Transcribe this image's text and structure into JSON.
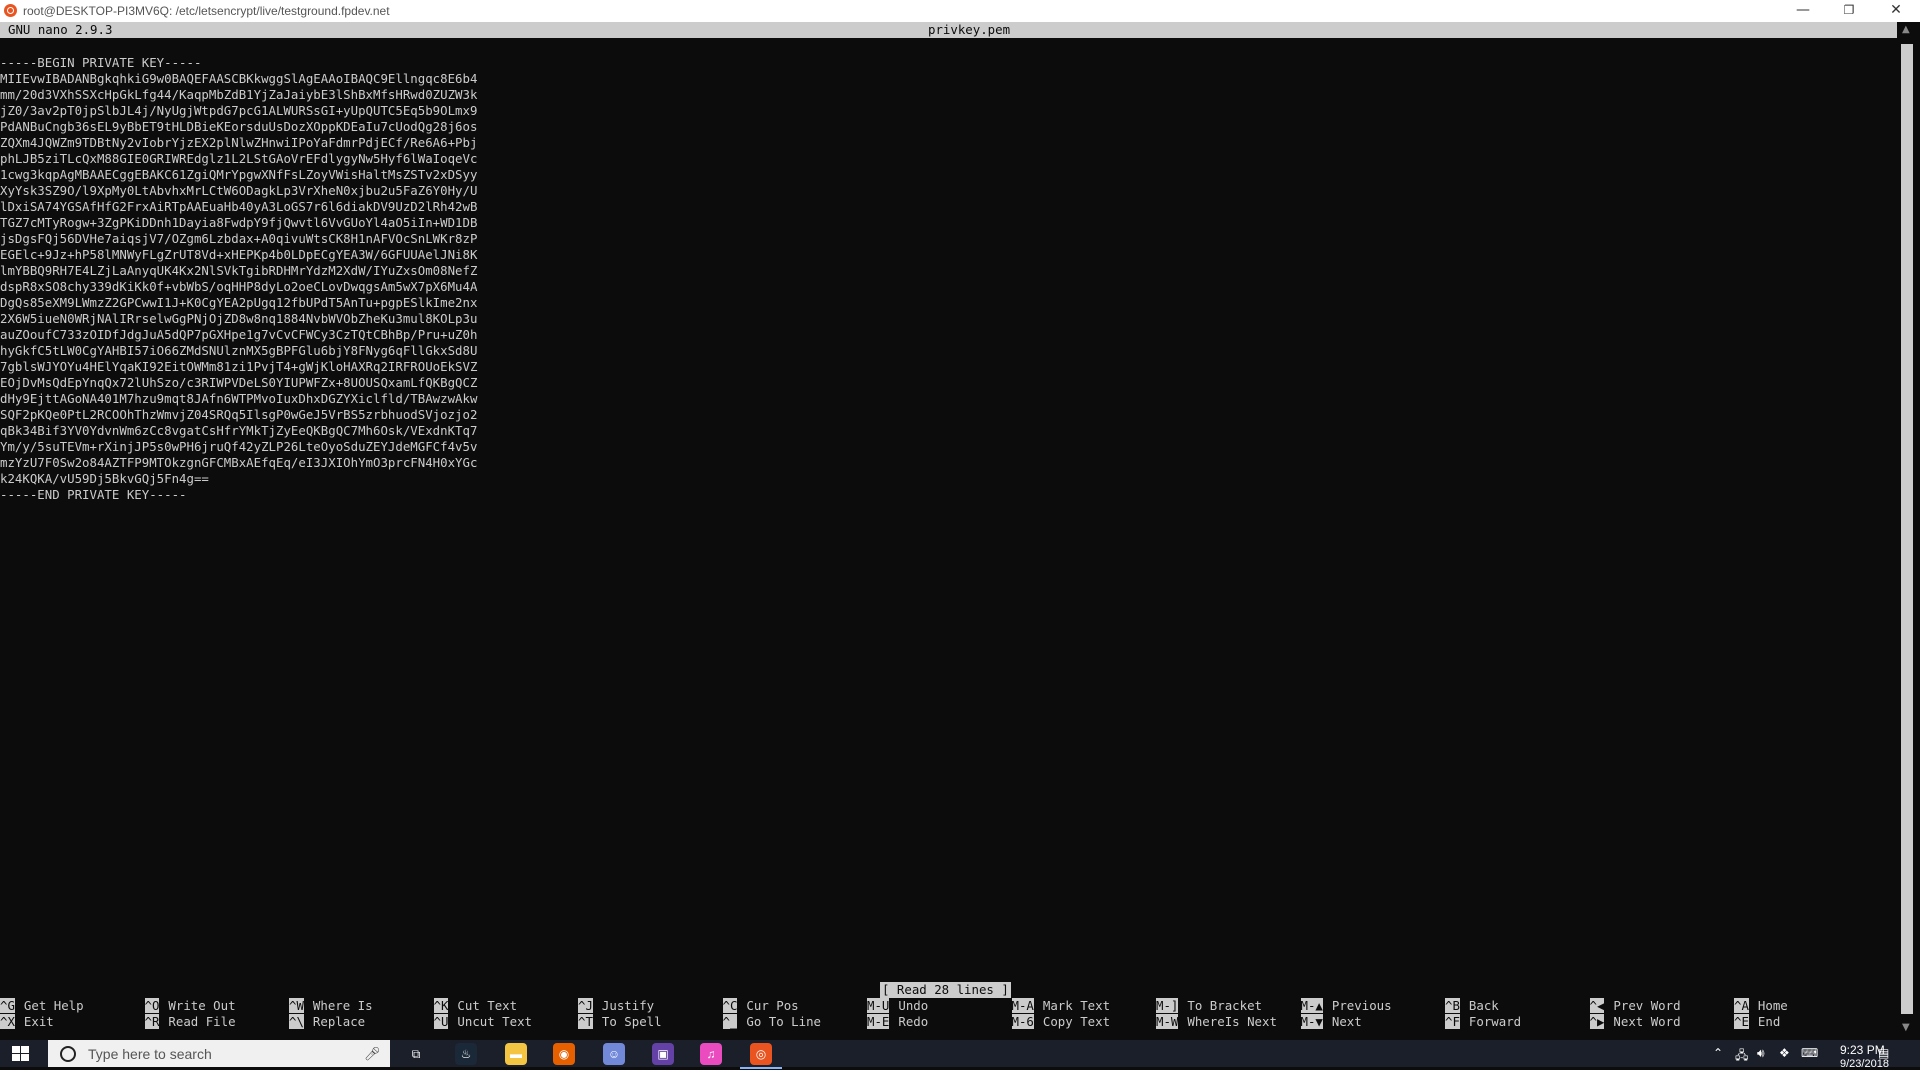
{
  "window": {
    "title": "root@DESKTOP-PI3MV6Q: /etc/letsencrypt/live/testground.fpdev.net",
    "minimize_glyph": "—",
    "maximize_glyph": "❐",
    "close_glyph": "✕"
  },
  "nano": {
    "version": "GNU nano 2.9.3",
    "filename": "privkey.pem",
    "status_message": "[ Read 28 lines ]",
    "lines": [
      "-----BEGIN PRIVATE KEY-----",
      "MIIEvwIBADANBgkqhkiG9w0BAQEFAASCBKkwggSlAgEAAoIBAQC9Ellngqc8E6b4",
      "mm/20d3VXhSSXcHpGkLfg44/KaqpMbZdB1YjZaJaiybE3lShBxMfsHRwd0ZUZW3k",
      "jZ0/3av2pT0jpSlbJL4j/NyUgjWtpdG7pcG1ALWURSsGI+yUpQUTC5Eq5b9OLmx9",
      "PdANBuCngb36sEL9yBbET9tHLDBieKEorsduUsDozXOppKDEaIu7cUodQg28j6os",
      "ZQXm4JQWZm9TDBtNy2vIobrYjzEX2plNlwZHnwiIPoYaFdmrPdjECf/Re6A6+Pbj",
      "phLJB5ziTLcQxM88GIE0GRIWREdglz1L2LStGAoVrEFdlygyNw5Hyf6lWaIoqeVc",
      "1cwg3kqpAgMBAAECggEBAKC61ZgiQMrYpgwXNfFsLZoyVWisHaltMsZSTv2xDSyy",
      "XyYsk3SZ9O/l9XpMy0LtAbvhxMrLCtW6ODagkLp3VrXheN0xjbu2u5FaZ6Y0Hy/U",
      "lDxiSA74YGSAfHfG2FrxAiRTpAAEuaHb40yA3LoGS7r6l6diakDV9UzD2lRh42wB",
      "TGZ7cMTyRogw+3ZgPKiDDnh1Dayia8FwdpY9fjQwvtl6VvGUoYl4aO5iIn+WD1DB",
      "jsDgsFQj56DVHe7aiqsjV7/OZgm6Lzbdax+A0qivuWtsCK8H1nAFVOcSnLWKr8zP",
      "EGElc+9Jz+hP58lMNWyFLgZrUT8Vd+xHEPKp4b0LDpECgYEA3W/6GFUUAelJNi8K",
      "lmYBBQ9RH7E4LZjLaAnyqUK4Kx2NlSVkTgibRDHMrYdzM2XdW/IYuZxsOm08NefZ",
      "dspR8xSO8chy339dKiKk0f+vbWbS/oqHHP8dyLo2oeCLovDwqgsAm5wX7pX6Mu4A",
      "DgQs85eXM9LWmzZ2GPCwwI1J+K0CgYEA2pUgq12fbUPdT5AnTu+pgpESlkIme2nx",
      "2X6W5iueN0WRjNAlIRrselwGgPNjOjZD8w8nq1884NvbWVObZheKu3mul8KOLp3u",
      "auZOoufC733zOIDfJdgJuA5dQP7pGXHpe1g7vCvCFWCy3CzTQtCBhBp/Pru+uZ0h",
      "hyGkfC5tLW0CgYAHBI57iO66ZMdSNUlznMX5gBPFGlu6bjY8FNyg6qFllGkxSd8U",
      "7gblsWJYOYu4HElYqaKI92EitOWMm81zi1PvjT4+gWjKloHAXRq2IRFROUoEkSVZ",
      "EOjDvMsQdEpYnqQx72lUhSzo/c3RIWPVDeLS0YIUPWFZx+8UOUSQxamLfQKBgQCZ",
      "dHy9EjttAGoNA401M7hzu9mqt8JAfn6WTPMvoIuxDhxDGZYXiclfld/TBAwzwAkw",
      "SQF2pKQe0PtL2RCOOhThzWmvjZ04SRQq5IlsgP0wGeJ5VrBS5zrbhuodSVjozjo2",
      "qBk34Bif3YV0YdvnWm6zCc8vgatCsHfrYMkTjZyEeQKBgQC7Mh6Osk/VExdnKTq7",
      "Ym/y/5suTEVm+rXinjJP5s0wPH6jruQf42yZLP26LteOyoSduZEYJdeMGFCf4v5v",
      "mzYzU7F0Sw2o84AZTFP9MTOkzgnGFCMBxAEfqEq/eI3JXIOhYmO3prcFN4H0xYGc",
      "k24KQKA/vU59Dj5BkvGQj5Fn4g==",
      "-----END PRIVATE KEY-----"
    ],
    "shortcuts": [
      {
        "top": {
          "key": "^G",
          "label": "Get Help"
        },
        "bottom": {
          "key": "^X",
          "label": "Exit"
        }
      },
      {
        "top": {
          "key": "^O",
          "label": "Write Out"
        },
        "bottom": {
          "key": "^R",
          "label": "Read File"
        }
      },
      {
        "top": {
          "key": "^W",
          "label": "Where Is"
        },
        "bottom": {
          "key": "^\\",
          "label": "Replace"
        }
      },
      {
        "top": {
          "key": "^K",
          "label": "Cut Text"
        },
        "bottom": {
          "key": "^U",
          "label": "Uncut Text"
        }
      },
      {
        "top": {
          "key": "^J",
          "label": "Justify"
        },
        "bottom": {
          "key": "^T",
          "label": "To Spell"
        }
      },
      {
        "top": {
          "key": "^C",
          "label": "Cur Pos"
        },
        "bottom": {
          "key": "^_",
          "label": "Go To Line"
        }
      },
      {
        "top": {
          "key": "M-U",
          "label": "Undo"
        },
        "bottom": {
          "key": "M-E",
          "label": "Redo"
        }
      },
      {
        "top": {
          "key": "M-A",
          "label": "Mark Text"
        },
        "bottom": {
          "key": "M-6",
          "label": "Copy Text"
        }
      },
      {
        "top": {
          "key": "M-]",
          "label": "To Bracket"
        },
        "bottom": {
          "key": "M-W",
          "label": "WhereIs Next"
        }
      },
      {
        "top": {
          "key": "M-▲",
          "label": "Previous"
        },
        "bottom": {
          "key": "M-▼",
          "label": "Next"
        }
      },
      {
        "top": {
          "key": "^B",
          "label": "Back"
        },
        "bottom": {
          "key": "^F",
          "label": "Forward"
        }
      },
      {
        "top": {
          "key": "^◀",
          "label": "Prev Word"
        },
        "bottom": {
          "key": "^▶",
          "label": "Next Word"
        }
      },
      {
        "top": {
          "key": "^A",
          "label": "Home"
        },
        "bottom": {
          "key": "^E",
          "label": "End"
        }
      }
    ]
  },
  "taskbar": {
    "search_placeholder": "Type here to search",
    "apps": [
      {
        "name": "task-view-icon",
        "glyph": "⧉",
        "color": "#1b1f2a"
      },
      {
        "name": "steam-icon",
        "glyph": "♨",
        "color": "#1b2838"
      },
      {
        "name": "file-explorer-icon",
        "glyph": "▬",
        "color": "#f4c542"
      },
      {
        "name": "firefox-icon",
        "glyph": "◉",
        "color": "#e66000"
      },
      {
        "name": "discord-icon",
        "glyph": "☺",
        "color": "#7289da"
      },
      {
        "name": "twitch-icon",
        "glyph": "▣",
        "color": "#6441a5"
      },
      {
        "name": "itunes-icon",
        "glyph": "♫",
        "color": "#ea4cc0"
      },
      {
        "name": "ubuntu-icon",
        "glyph": "◎",
        "color": "#e95420"
      }
    ],
    "clock_time": "9:23 PM",
    "clock_date": "9/23/2018"
  },
  "colors": {
    "terminal_bg": "#0c0c0c",
    "terminal_fg": "#cccccc",
    "ubuntu_orange": "#e95420",
    "taskbar_bg": "#1b1f2a"
  }
}
